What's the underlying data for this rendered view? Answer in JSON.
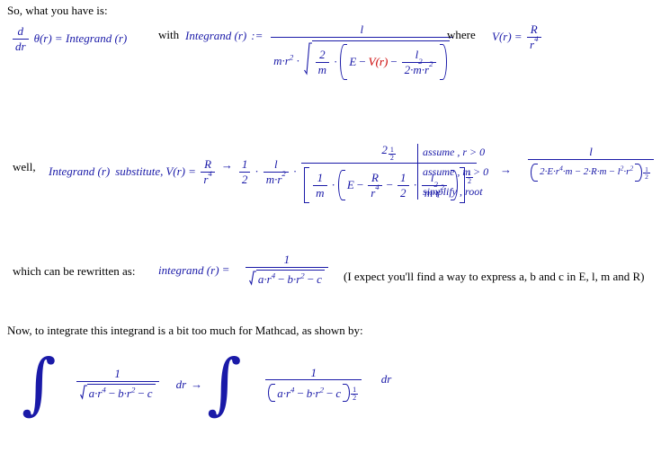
{
  "document": {
    "type": "mathcad-worksheet",
    "background": "#ffffff",
    "text_color": "#000000",
    "math_color": "#1a1aa8",
    "user_function_color": "#cc0000"
  },
  "line1": {
    "intro": "So, what you have is:",
    "lhs_d": "d",
    "lhs_dr": "dr",
    "lhs_theta": "θ(r)",
    "equals": "=",
    "lhs_rhs": "Integrand (r)",
    "with": "with",
    "def_name": "Integrand (r)",
    "define_op": ":=",
    "numerator": "l",
    "den_m_r": "m·r",
    "den_m_r_exp": "2",
    "den_two": "2",
    "den_m": "m",
    "inner_E": "E",
    "inner_minus1": "−",
    "inner_V": "V(r)",
    "inner_minus2": "−",
    "inner_l": "l",
    "inner_l_exp": "2",
    "inner_den": "2·m·r",
    "inner_den_exp": "2",
    "where": "where",
    "V_name": "V(r)",
    "V_equals": "=",
    "V_num": "R",
    "V_den": "r",
    "V_den_exp": "4"
  },
  "line2": {
    "well": "well,",
    "expr_name": "Integrand (r)",
    "keyword": "substitute",
    "comma": ",",
    "sub_V": "V(r)",
    "sub_equals": "=",
    "sub_num": "R",
    "sub_den": "r",
    "sub_den_exp": "4",
    "arrow": "→",
    "half_num": "1",
    "half_den": "2",
    "f2_num": "l",
    "f2_den": "m·r",
    "f2_den_exp": "2",
    "big_num_base": "2",
    "big_num_exp_num": "1",
    "big_num_exp_den": "2",
    "bk_one": "1",
    "bk_m": "m",
    "bk_E": "E",
    "bk_minus1": "−",
    "bk_R": "R",
    "bk_r": "r",
    "bk_r_exp": "4",
    "bk_minus2": "−",
    "bk_half_num": "1",
    "bk_half_den": "2",
    "bk_l": "l",
    "bk_l_exp": "2",
    "bk_mr": "m·r",
    "bk_mr_exp": "2",
    "bk_exp_num": "1",
    "bk_exp_den": "2",
    "modifiers": [
      "assume , r > 0",
      "assume , m > 0",
      "simplify , root"
    ],
    "result_arrow": "→",
    "result_num": "l",
    "result_den_p1": "2·E·r",
    "result_den_p1_exp": "4",
    "result_den_p2": "·m",
    "result_den_minus1": "−",
    "result_den_p3": "2·R·m",
    "result_den_minus2": "−",
    "result_den_l": "l",
    "result_den_l_exp": "2",
    "result_den_r": "·r",
    "result_den_r_exp": "2",
    "result_exp_num": "1",
    "result_exp_den": "2"
  },
  "line3": {
    "label": "which can be rewritten as:",
    "name": "integrand (r)",
    "equals": "=",
    "numerator": "1",
    "den_a": "a·r",
    "den_a_exp": "4",
    "den_minus1": "−",
    "den_b": "b·r",
    "den_b_exp": "2",
    "den_minus2": "−",
    "den_c": "c",
    "note": "(I expect you'll find a way to express  a,  b and  c in  E,  l,  m and  R)"
  },
  "line4": {
    "label": "Now, to integrate this integrand is a bit too much for Mathcad, as shown by:",
    "int_symbol": "∫",
    "left_num": "1",
    "left_den_a": "a·r",
    "left_den_a_exp": "4",
    "left_den_minus1": "−",
    "left_den_b": "b·r",
    "left_den_b_exp": "2",
    "left_den_minus2": "−",
    "left_den_c": "c",
    "left_dr": "dr",
    "arrow": "→",
    "right_num": "1",
    "right_den_a": "a·r",
    "right_den_a_exp": "4",
    "right_den_minus1": "−",
    "right_den_b": "b·r",
    "right_den_b_exp": "2",
    "right_den_minus2": "−",
    "right_den_c": "c",
    "right_exp_num": "1",
    "right_exp_den": "2",
    "right_dr": "dr"
  }
}
